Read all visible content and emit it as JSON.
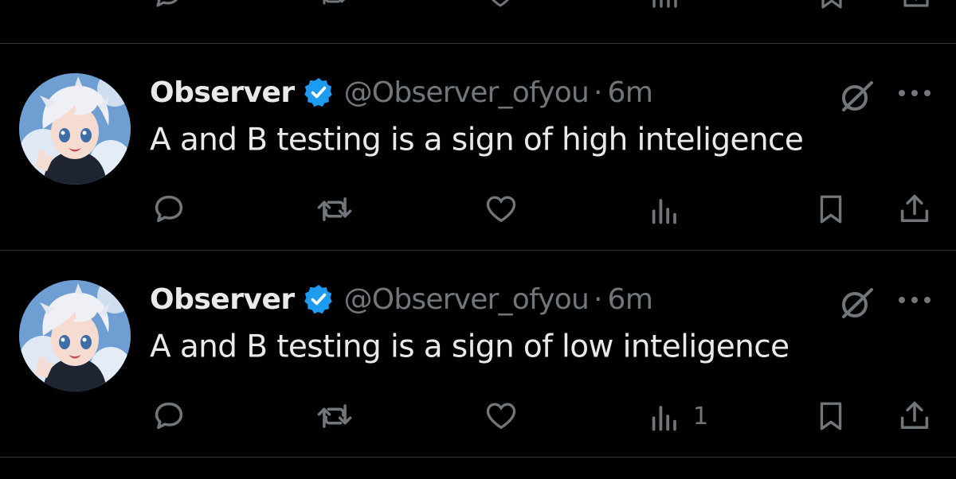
{
  "colors": {
    "background": "#000000",
    "divider": "#2f3336",
    "text_primary": "#e7e9ea",
    "text_secondary": "#71767b",
    "verified_badge": "#1d9bf0"
  },
  "tweets": [
    {
      "display_name": "Observer",
      "verified": true,
      "handle": "@Observer_ofyou",
      "separator": "·",
      "time": "6m",
      "text": "A and B testing is a sign of high inteligence",
      "avatar_icon": "anime-avatar",
      "actions": {
        "reply_icon": "reply-icon",
        "repost_icon": "repost-icon",
        "like_icon": "like-icon",
        "views_icon": "views-icon",
        "views_count": "",
        "bookmark_icon": "bookmark-icon",
        "share_icon": "share-icon"
      }
    },
    {
      "display_name": "Observer",
      "verified": true,
      "handle": "@Observer_ofyou",
      "separator": "·",
      "time": "6m",
      "text": "A and B testing is a sign of low inteligence",
      "avatar_icon": "anime-avatar",
      "actions": {
        "reply_icon": "reply-icon",
        "repost_icon": "repost-icon",
        "like_icon": "like-icon",
        "views_icon": "views-icon",
        "views_count": "1",
        "bookmark_icon": "bookmark-icon",
        "share_icon": "share-icon"
      }
    }
  ]
}
